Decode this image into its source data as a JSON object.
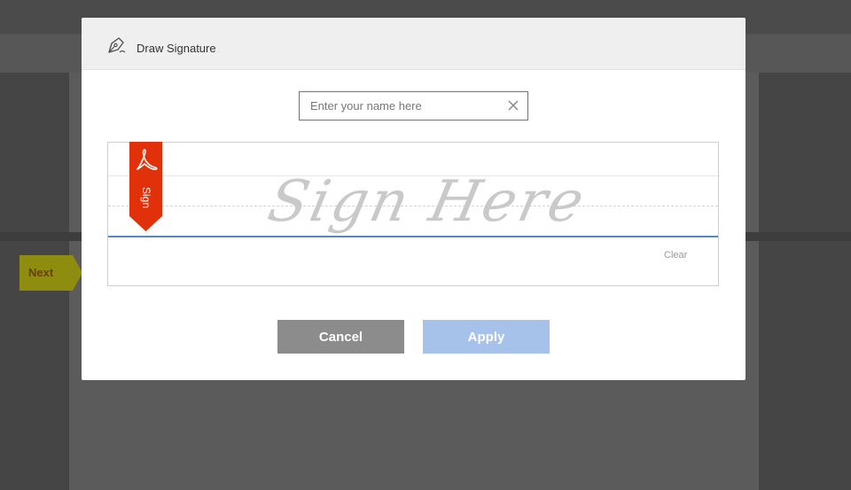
{
  "background": {
    "next_label": "Next"
  },
  "dialog": {
    "title": "Draw Signature",
    "icon": "pen-nib-icon",
    "name_input": {
      "placeholder": "Enter your name here",
      "value": ""
    },
    "signature_pad": {
      "watermark": "Sign Here",
      "ribbon_label": "Sign",
      "ribbon_icon": "acrobat-logo-icon",
      "clear_label": "Clear"
    },
    "buttons": {
      "cancel_label": "Cancel",
      "apply_label": "Apply"
    }
  },
  "colors": {
    "ribbon": "#e0310b",
    "input_border": "#3f7fbf",
    "baseline": "#4f8ac2",
    "apply_disabled": "#a6c1ea",
    "cancel": "#8c8c8c",
    "next_tag": "#9b9a12"
  }
}
